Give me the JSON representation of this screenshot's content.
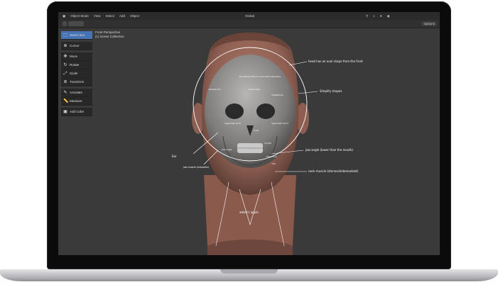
{
  "menubar": {
    "mode": "Object Mode",
    "items": [
      "View",
      "Select",
      "Add",
      "Object"
    ]
  },
  "header": {
    "orientation": "Global",
    "options_label": "Options"
  },
  "viewport": {
    "view_name": "Front Perspective",
    "collection": "(1) Scene Collection"
  },
  "toolbar": {
    "tools": [
      {
        "label": "Select Box",
        "icon": "select-box-icon",
        "active": true
      },
      {
        "label": "Cursor",
        "icon": "cursor-icon",
        "active": false
      },
      {
        "label": "Move",
        "icon": "move-icon",
        "active": false
      },
      {
        "label": "Rotate",
        "icon": "rotate-icon",
        "active": false
      },
      {
        "label": "Scale",
        "icon": "scale-icon",
        "active": false
      },
      {
        "label": "Transform",
        "icon": "transform-icon",
        "active": false
      },
      {
        "label": "Annotate",
        "icon": "annotate-icon",
        "active": false
      },
      {
        "label": "Measure",
        "icon": "measure-icon",
        "active": false
      },
      {
        "label": "Add Cube",
        "icon": "add-cube-icon",
        "active": false
      }
    ]
  },
  "annotations": {
    "head_oval": "head has an oval shape from the front",
    "simplify": "Simplify shapes",
    "skull_note": "the outline of the is a more direct expression",
    "temple": "temple line",
    "brow": "brow ridge",
    "cheek": "cheekbone",
    "zygomatic": "zygomatic arch",
    "zygomatic_bone": "zygomatic bone",
    "nose": "nose",
    "mouth": "mouth",
    "jaw_angle": "jaw angle",
    "cheek_fold": "cheek fold",
    "ear": "Ear",
    "mastoid": "jaw muscle (masseter)",
    "jaw_angle_long": "jaw angle (lower than the mouth)",
    "chin": "chin",
    "neck_muscle": "neck muscle (sternocleidomastoid)",
    "adams_apple": "adam's apple"
  },
  "colors": {
    "accent": "#4772b3",
    "viewport_bg": "#3a3a3a",
    "skin": "#9a6a5c"
  }
}
